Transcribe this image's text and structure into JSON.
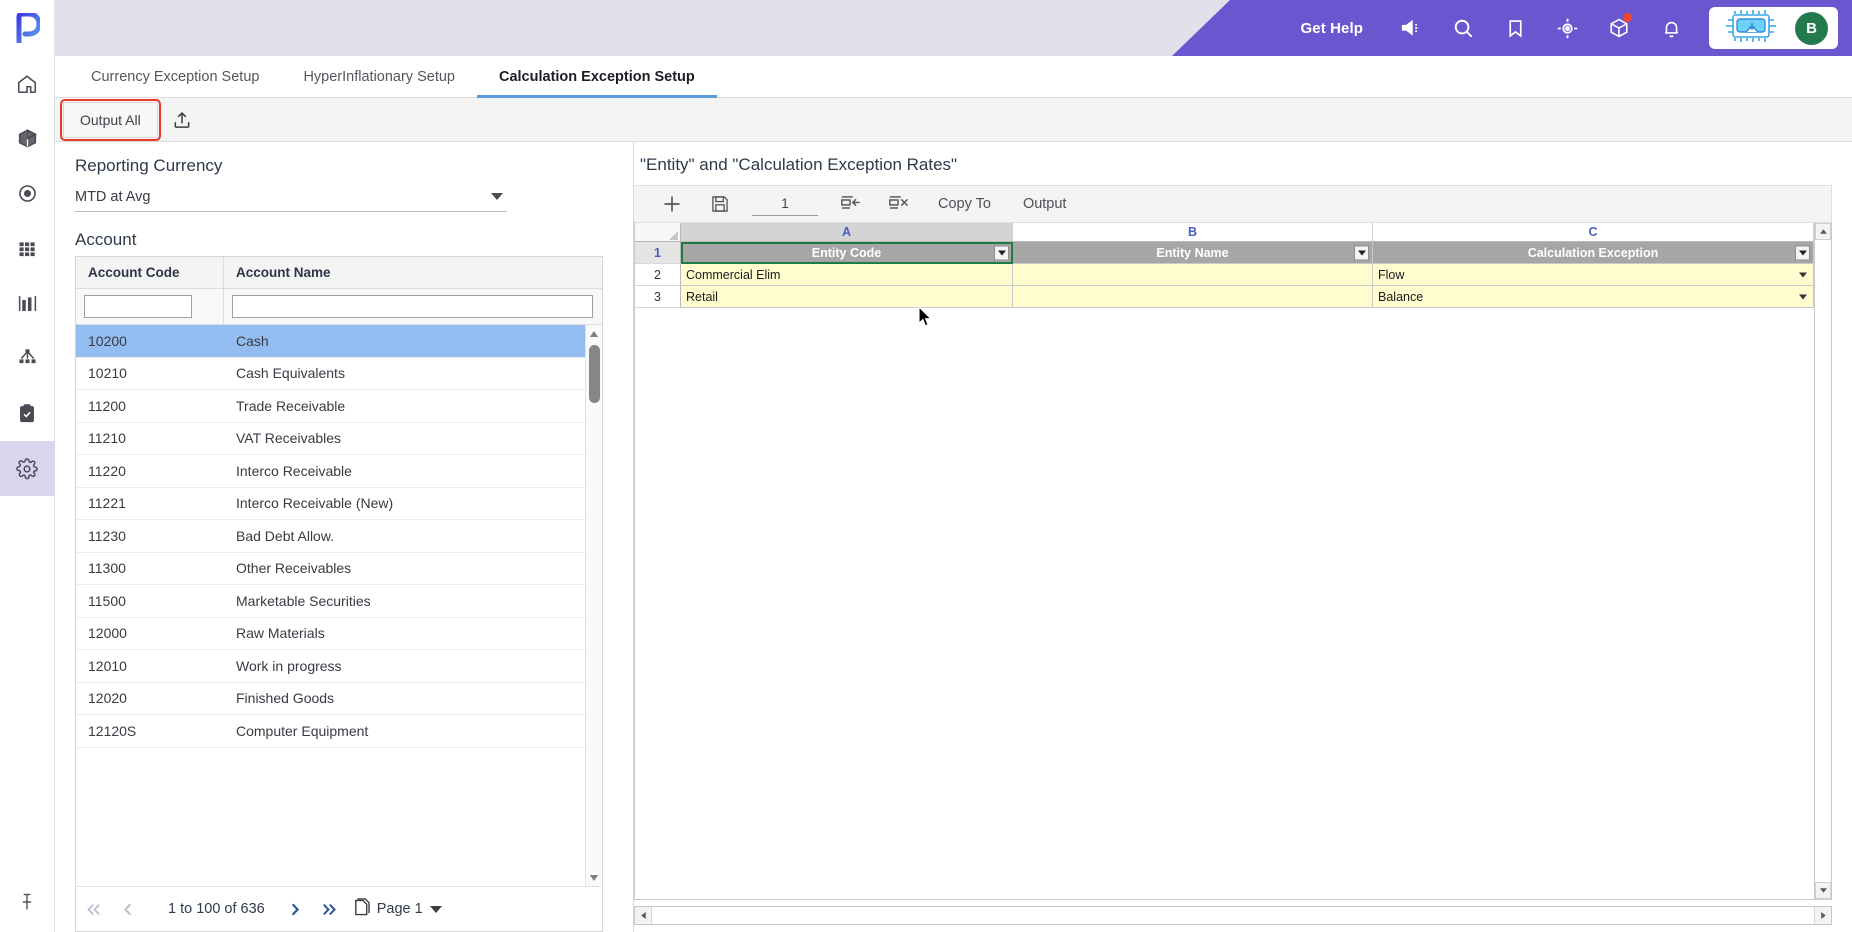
{
  "app": {
    "logo_letter": "P"
  },
  "sidebar": {
    "items": [
      {
        "name": "home-icon",
        "label": "Home"
      },
      {
        "name": "cube-icon",
        "label": "Models"
      },
      {
        "name": "target-icon",
        "label": "Actions"
      },
      {
        "name": "grid-icon",
        "label": "Boards"
      },
      {
        "name": "bar-chart-icon",
        "label": "Reports"
      },
      {
        "name": "hierarchy-icon",
        "label": "Hierarchy"
      },
      {
        "name": "clipboard-check-icon",
        "label": "Tasks"
      },
      {
        "name": "gear-icon",
        "label": "Settings",
        "active": true
      }
    ],
    "pin_label": "Pin"
  },
  "header": {
    "get_help": "Get Help",
    "icons": [
      {
        "name": "megaphone-icon"
      },
      {
        "name": "search-icon"
      },
      {
        "name": "bookmark-icon"
      },
      {
        "name": "target-crosshair-icon"
      },
      {
        "name": "cube-badge-icon",
        "badge": true
      },
      {
        "name": "bell-icon"
      }
    ],
    "assistant_icon": "chip-assistant-icon",
    "avatar_initial": "B",
    "avatar_color": "#237a4d",
    "brand_color": "#6a57cf"
  },
  "tabs": [
    {
      "label": "Currency Exception Setup",
      "active": false
    },
    {
      "label": "HyperInflationary Setup",
      "active": false
    },
    {
      "label": "Calculation Exception Setup",
      "active": true
    }
  ],
  "toolbar": {
    "output_all_label": "Output All",
    "export_icon": "upload-export-icon",
    "highlight_color": "#e8392b"
  },
  "left_panel": {
    "reporting_currency_label": "Reporting Currency",
    "reporting_currency_value": "MTD at Avg",
    "account_label": "Account",
    "columns": [
      "Account Code",
      "Account Name"
    ],
    "filter_code_value": "",
    "filter_name_value": "",
    "rows": [
      {
        "code": "10200",
        "name": "Cash",
        "selected": true
      },
      {
        "code": "10210",
        "name": "Cash Equivalents",
        "selected": false
      },
      {
        "code": "11200",
        "name": "Trade Receivable",
        "selected": false
      },
      {
        "code": "11210",
        "name": "VAT Receivables",
        "selected": false
      },
      {
        "code": "11220",
        "name": "Interco Receivable",
        "selected": false
      },
      {
        "code": "11221",
        "name": "Interco Receivable (New)",
        "selected": false
      },
      {
        "code": "11230",
        "name": "Bad Debt Allow.",
        "selected": false
      },
      {
        "code": "11300",
        "name": "Other Receivables",
        "selected": false
      },
      {
        "code": "11500",
        "name": "Marketable Securities",
        "selected": false
      },
      {
        "code": "12000",
        "name": "Raw Materials",
        "selected": false
      },
      {
        "code": "12010",
        "name": "Work in progress",
        "selected": false
      },
      {
        "code": "12020",
        "name": "Finished Goods",
        "selected": false
      },
      {
        "code": "12120S",
        "name": "Computer Equipment",
        "selected": false
      }
    ],
    "pager": {
      "first_icon": "double-chevron-left-icon",
      "prev_icon": "chevron-left-icon",
      "range_text": "1 to 100 of 636",
      "next_icon": "chevron-right-icon",
      "last_icon": "double-chevron-right-icon",
      "pages_icon": "pages-icon",
      "page_label": "Page 1"
    }
  },
  "right_panel": {
    "title": "\"Entity\" and \"Calculation Exception Rates\"",
    "sheet_toolbar": {
      "add_icon": "plus-icon",
      "save_icon": "save-floppy-icon",
      "row_count_value": "1",
      "insert_row_icon": "insert-row-icon",
      "delete_row_icon": "delete-row-icon",
      "copy_to_label": "Copy To",
      "output_label": "Output"
    },
    "sheet": {
      "column_letters": [
        "A",
        "B",
        "C"
      ],
      "active_column": "A",
      "active_cell": "A1",
      "header_row_number": "1",
      "headers": [
        "Entity Code",
        "Entity Name",
        "Calculation Exception"
      ],
      "rows": [
        {
          "num": "2",
          "cells": [
            "Commercial Elim",
            "",
            "Flow"
          ]
        },
        {
          "num": "3",
          "cells": [
            "Retail",
            "",
            "Balance"
          ]
        }
      ],
      "cell_fill_color": "#fffccf",
      "header_fill_color": "#a6a6a6",
      "active_outline_color": "#1f7a44"
    }
  }
}
